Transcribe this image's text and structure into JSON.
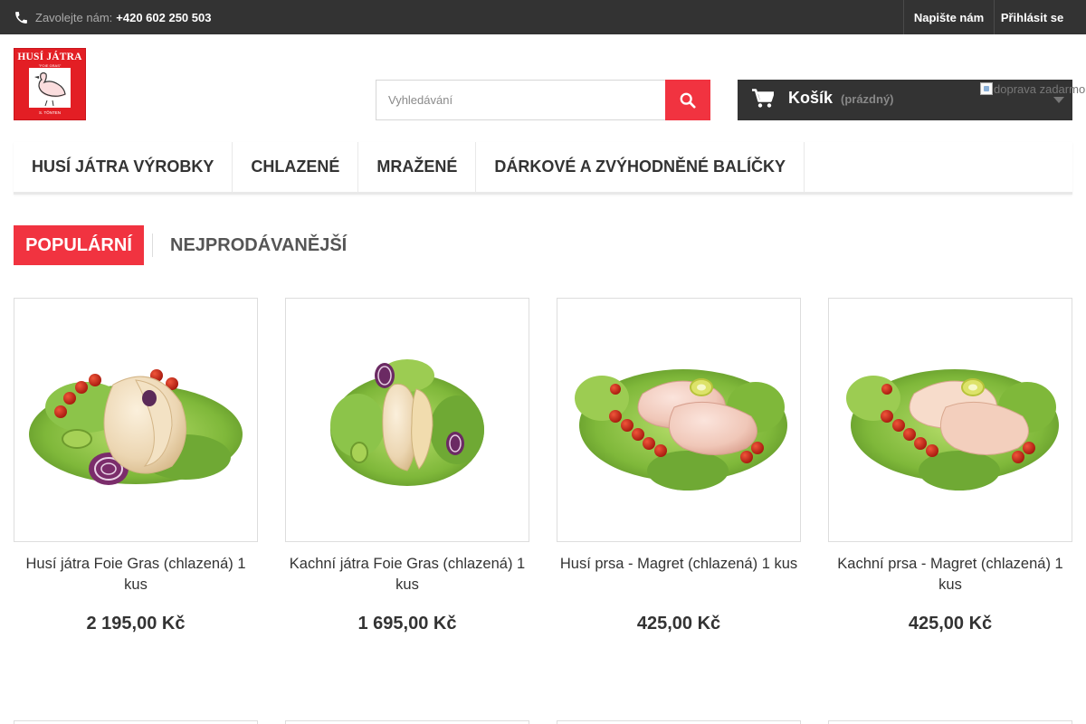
{
  "topbar": {
    "phone_label": "Zavolejte nám:",
    "phone_number": "+420 602 250 503",
    "write_us": "Napište nám",
    "login": "Přihlásit se"
  },
  "logo": {
    "title": "HUSÍ JÁTRA",
    "subtitle": "\"FOIE GRAS\"",
    "maker": "S. TÖNTEN"
  },
  "search": {
    "placeholder": "Vyhledávání"
  },
  "cart": {
    "title": "Košík",
    "status": "(prázdný)"
  },
  "free_shipping_alt": "doprava zadarmo",
  "menu": {
    "items": [
      {
        "label": "HUSÍ JÁTRA VÝROBKY"
      },
      {
        "label": "CHLAZENÉ"
      },
      {
        "label": "MRAŽENÉ"
      },
      {
        "label": "DÁRKOVÉ A ZVÝHODNĚNÉ BALÍČKY"
      }
    ]
  },
  "tabs": {
    "popular": "POPULÁRNÍ",
    "bestsellers": "NEJPRODÁVANĚJŠÍ"
  },
  "products": [
    {
      "name": "Husí játra Foie Gras (chlazená) 1 kus",
      "price": "2 195,00 Kč"
    },
    {
      "name": "Kachní játra Foie Gras (chlazená) 1 kus",
      "price": "1 695,00 Kč"
    },
    {
      "name": "Husí prsa - Magret (chlazená) 1 kus",
      "price": "425,00 Kč"
    },
    {
      "name": "Kachní prsa - Magret (chlazená) 1 kus",
      "price": "425,00 Kč"
    }
  ],
  "colors": {
    "accent": "#f13340",
    "dark": "#333333",
    "logo_red": "#e31e24"
  },
  "icons": [
    "phone-icon",
    "search-icon",
    "cart-icon",
    "chevron-down-icon"
  ]
}
